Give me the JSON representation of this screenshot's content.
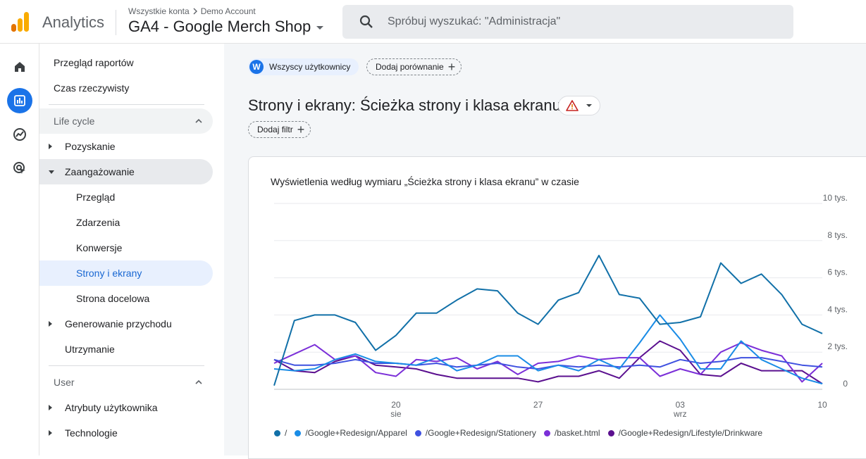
{
  "header": {
    "app_name": "Analytics",
    "breadcrumb_accounts": "Wszystkie konta",
    "breadcrumb_account": "Demo Account",
    "property": "GA4 - Google Merch Shop",
    "search_placeholder": "Spróbuj wyszukać: \"Administracja\""
  },
  "rail": {
    "items": [
      {
        "name": "home-icon"
      },
      {
        "name": "reports-icon",
        "active": true
      },
      {
        "name": "explore-icon"
      },
      {
        "name": "advertising-icon"
      }
    ]
  },
  "nav": {
    "overview": "Przegląd raportów",
    "realtime": "Czas rzeczywisty",
    "lifecycle": "Life cycle",
    "acquisition": "Pozyskanie",
    "engagement": "Zaangażowanie",
    "engagement_overview": "Przegląd",
    "events": "Zdarzenia",
    "conversions": "Konwersje",
    "pages_screens": "Strony i ekrany",
    "landing_page": "Strona docelowa",
    "monetization": "Generowanie przychodu",
    "retention": "Utrzymanie",
    "user": "User",
    "user_attributes": "Atrybuty użytkownika",
    "tech": "Technologie"
  },
  "main": {
    "segment_initial": "W",
    "segment_label": "Wszyscy użytkownicy",
    "compare_label": "Dodaj porównanie",
    "title": "Strony i ekrany: Ścieżka strony i klasa ekranu",
    "filter_label": "Dodaj filtr",
    "card_title": "Wyświetlenia według wymiaru „Ścieżka strony i klasa ekranu” w czasie"
  },
  "chart_data": {
    "type": "line",
    "title": "Wyświetlenia według wymiaru „Ścieżka strony i klasa ekranu” w czasie",
    "ylim": [
      0,
      10000
    ],
    "y_ticks": [
      "0",
      "2 tys.",
      "4 tys.",
      "6 tys.",
      "8 tys.",
      "10 tys."
    ],
    "y_tick_values": [
      0,
      2000,
      4000,
      6000,
      8000,
      10000
    ],
    "y_axis_side": "right",
    "x_ticks": [
      {
        "day": "20",
        "month": "sie",
        "index": 6
      },
      {
        "day": "27",
        "month": "",
        "index": 13
      },
      {
        "day": "03",
        "month": "wrz",
        "index": 20
      },
      {
        "day": "10",
        "month": "",
        "index": 27
      }
    ],
    "grid": true,
    "legend_position": "bottom",
    "series": [
      {
        "name": "/",
        "color": "#1170a8",
        "values": [
          200,
          3700,
          4000,
          4000,
          3600,
          2100,
          2900,
          4100,
          4100,
          4800,
          5400,
          5300,
          4100,
          3500,
          4800,
          5200,
          7200,
          5100,
          4900,
          3500,
          3600,
          3900,
          6800,
          5700,
          6200,
          5100,
          3500,
          3000
        ]
      },
      {
        "name": "/Google+Redesign/Apparel",
        "color": "#1a8ce6",
        "values": [
          1100,
          1000,
          1100,
          1600,
          1900,
          1500,
          1400,
          1300,
          1700,
          1000,
          1300,
          1800,
          1800,
          1000,
          1300,
          1000,
          1600,
          1100,
          2500,
          4000,
          2700,
          1100,
          1100,
          2600,
          1600,
          1100,
          600,
          300
        ]
      },
      {
        "name": "/Google+Redesign/Stationery",
        "color": "#3f51e0",
        "values": [
          1600,
          1300,
          1300,
          1400,
          1600,
          1400,
          1400,
          1300,
          1400,
          1200,
          1300,
          1400,
          1200,
          1100,
          1300,
          1200,
          1300,
          1200,
          1300,
          1200,
          1600,
          1400,
          1500,
          1700,
          1700,
          1500,
          1300,
          1200
        ]
      },
      {
        "name": "/basket.html",
        "color": "#7b2fd8",
        "values": [
          1400,
          1900,
          2400,
          1600,
          1800,
          900,
          700,
          1600,
          1500,
          1700,
          1100,
          1500,
          800,
          1400,
          1500,
          1800,
          1600,
          1700,
          1700,
          700,
          1100,
          800,
          2000,
          2500,
          2100,
          1800,
          400,
          1400
        ]
      },
      {
        "name": "/Google+Redesign/Lifestyle/Drinkware",
        "color": "#5b108f",
        "values": [
          1600,
          1000,
          900,
          1500,
          1800,
          1300,
          1200,
          1100,
          800,
          600,
          600,
          600,
          600,
          400,
          700,
          700,
          1000,
          600,
          1700,
          2600,
          2100,
          800,
          700,
          1400,
          1000,
          1000,
          1000,
          300
        ]
      }
    ]
  }
}
